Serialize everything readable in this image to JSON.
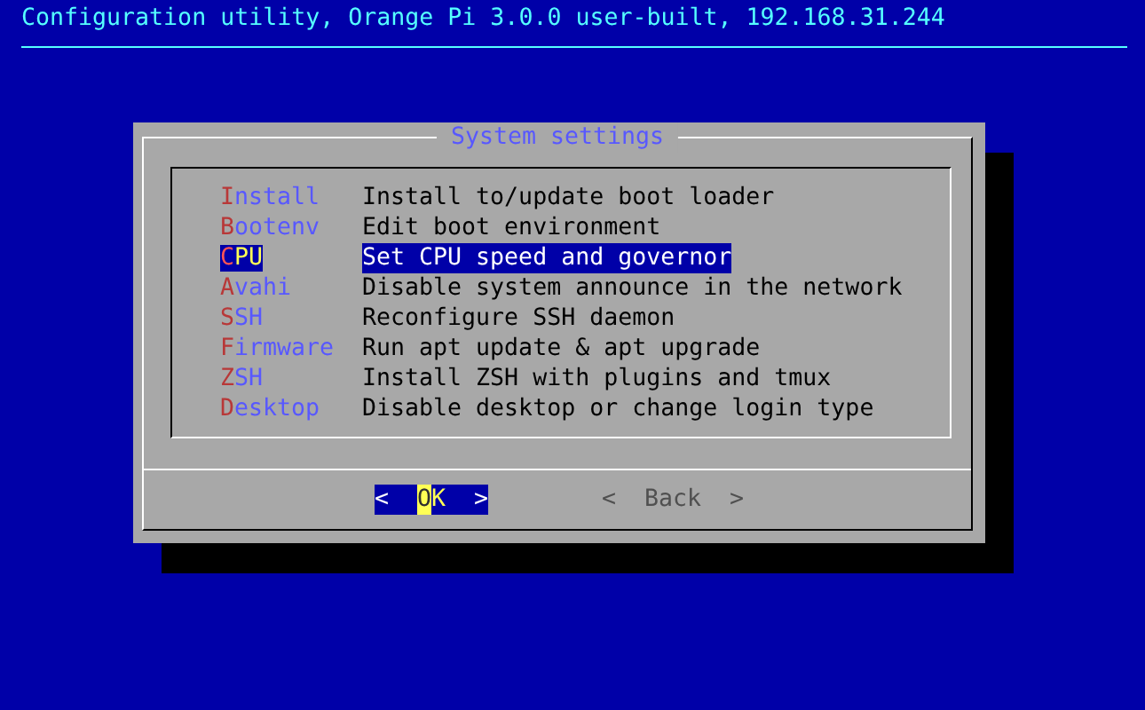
{
  "header": {
    "title": "Configuration utility, Orange Pi 3.0.0 user-built, 192.168.31.244"
  },
  "dialog": {
    "title": "System settings",
    "items": [
      {
        "tag": "Install",
        "description": "Install to/update boot loader",
        "selected": false
      },
      {
        "tag": "Bootenv",
        "description": "Edit boot environment",
        "selected": false
      },
      {
        "tag": "CPU",
        "description": "Set CPU speed and governor",
        "selected": true
      },
      {
        "tag": "Avahi",
        "description": "Disable system announce in the network",
        "selected": false
      },
      {
        "tag": "SSH",
        "description": "Reconfigure SSH daemon",
        "selected": false
      },
      {
        "tag": "Firmware",
        "description": "Run apt update & apt upgrade",
        "selected": false
      },
      {
        "tag": "ZSH",
        "description": "Install ZSH with plugins and tmux",
        "selected": false
      },
      {
        "tag": "Desktop",
        "description": "Disable desktop or change login type",
        "selected": false
      }
    ],
    "buttons": [
      {
        "open": "<",
        "label": "OK",
        "close": ">",
        "selected": true
      },
      {
        "open": "<",
        "label": "Back",
        "close": ">",
        "selected": false
      }
    ]
  }
}
